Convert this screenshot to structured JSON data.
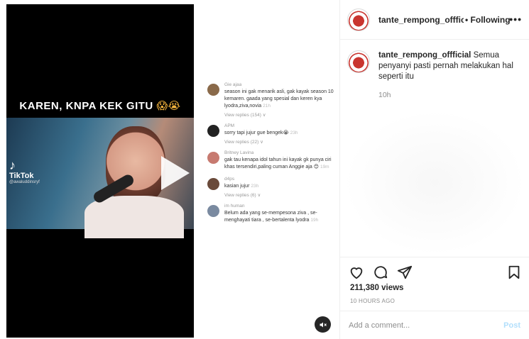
{
  "video": {
    "overlay_caption": "KAREN, KNPA KEK GITU",
    "overlay_emoji": "😱😭",
    "watermark_name": "TikTok",
    "watermark_user": "@awaluddinsryf",
    "comments": [
      {
        "user": "Gie ajaa",
        "text": "season ini gak menarik asli, gak kayak season 10 kemaren. gaada yang spesial dan keren kya lyodra,ziva,novia",
        "time": "21h",
        "replies": "View replies (154) ∨",
        "color": "#8a6a4a"
      },
      {
        "user": "APM",
        "text": "sorry tapi jujur gue bengek😭",
        "time": "23h",
        "replies": "View replies (22) ∨",
        "color": "#222222"
      },
      {
        "user": "Britney Lavina",
        "text": "gak tau kenapa idol tahun ini kayak gk punya ciri khas tersendiri,paling cuman Anggie aja 😊",
        "time": "19m",
        "replies": "",
        "color": "#c77a70"
      },
      {
        "user": "d4ps",
        "text": "kasian jujur",
        "time": "23h",
        "replies": "View replies (6) ∨",
        "color": "#6a4a3a"
      },
      {
        "user": "im human",
        "text": "Belum ada yang se-mempesona ziva , se-menghayati tiara , se-bertalenta lyodra",
        "time": "19h",
        "replies": "",
        "color": "#7a8aa0"
      }
    ]
  },
  "header": {
    "username": "tante_rempong_offficial",
    "follow_status": "• Following"
  },
  "caption": {
    "username": "tante_rempong_offficial",
    "text": "Semua penyanyi pasti pernah melakukan hal seperti itu",
    "time": "10h"
  },
  "stats": {
    "views": "211,380 views",
    "ago": "10 HOURS AGO"
  },
  "comment_box": {
    "placeholder": "Add a comment...",
    "post_label": "Post"
  },
  "icons": {
    "like": "heart-icon",
    "comment": "comment-icon",
    "share": "paper-plane-icon",
    "save": "bookmark-icon",
    "mute": "speaker-muted-icon",
    "more": "more-options-icon"
  }
}
